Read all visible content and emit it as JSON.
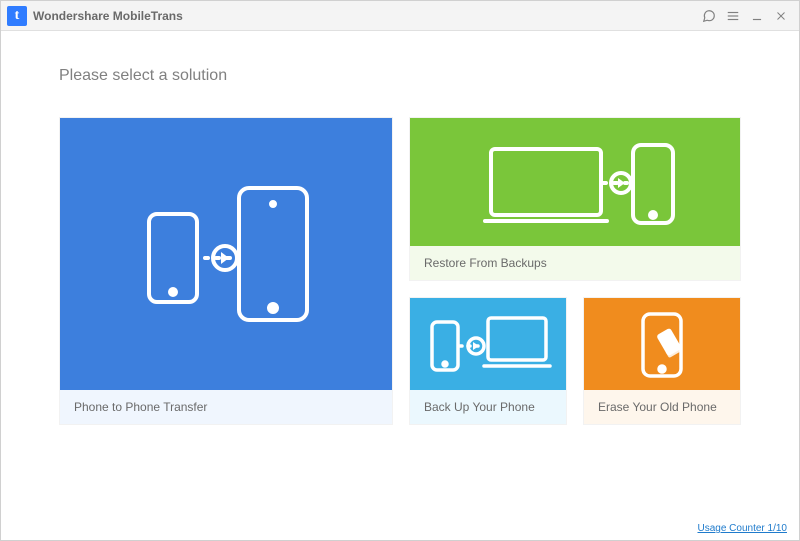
{
  "app": {
    "title": "Wondershare MobileTrans"
  },
  "heading": "Please select a solution",
  "cards": {
    "transfer": "Phone to Phone Transfer",
    "restore": "Restore From Backups",
    "backup": "Back Up Your Phone",
    "erase": "Erase Your Old Phone"
  },
  "footer": {
    "usage": "Usage Counter 1/10"
  },
  "colors": {
    "blue": "#3d7fdd",
    "green": "#7ac63a",
    "cyan": "#3aafe4",
    "orange": "#f08c1e"
  }
}
